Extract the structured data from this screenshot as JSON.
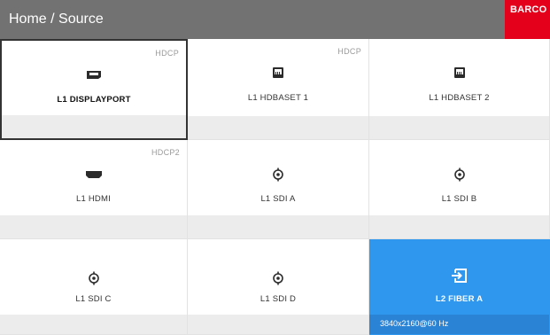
{
  "header": {
    "title": "Home / Source",
    "brand": "BARCO"
  },
  "colors": {
    "header_bg": "#727272",
    "brand_red": "#e4001b",
    "active_blue": "#2f97ee"
  },
  "sources": [
    {
      "label": "L1 DISPLAYPORT",
      "badge": "HDCP",
      "icon": "displayport-icon",
      "state": "focused"
    },
    {
      "label": "L1 HDBASET 1",
      "badge": "HDCP",
      "icon": "hdbaset-icon"
    },
    {
      "label": "L1 HDBASET 2",
      "badge": "",
      "icon": "hdbaset-icon"
    },
    {
      "label": "L1 HDMI",
      "badge": "HDCP2",
      "icon": "hdmi-icon"
    },
    {
      "label": "L1 SDI A",
      "badge": "",
      "icon": "sdi-icon"
    },
    {
      "label": "L1 SDI B",
      "badge": "",
      "icon": "sdi-icon"
    },
    {
      "label": "L1 SDI C",
      "badge": "",
      "icon": "sdi-icon"
    },
    {
      "label": "L1 SDI D",
      "badge": "",
      "icon": "sdi-icon"
    },
    {
      "label": "L2 FIBER A",
      "badge": "",
      "icon": "input-icon",
      "state": "active",
      "resolution": "3840x2160@60 Hz"
    }
  ]
}
